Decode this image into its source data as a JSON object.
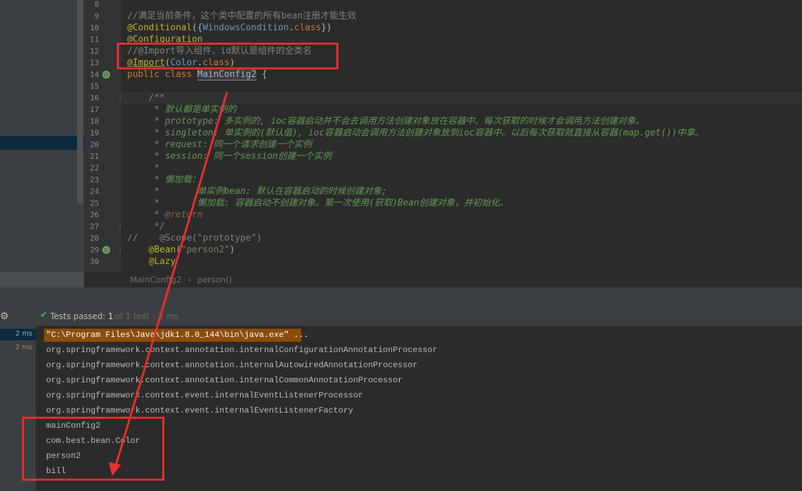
{
  "editor": {
    "line_numbers": [
      "8",
      "9",
      "10",
      "11",
      "12",
      "13",
      "14",
      "15",
      "16",
      "17",
      "18",
      "19",
      "20",
      "21",
      "22",
      "23",
      "24",
      "25",
      "26",
      "27",
      "28",
      "29",
      "30"
    ],
    "code": {
      "l9": "//满足当前条件，这个类中配置的所有bean注册才能生效",
      "l10_a": "@Conditional",
      "l10_b": "({",
      "l10_c": "WindowsCondition",
      "l10_d": ".",
      "l10_e": "class",
      "l10_f": "})",
      "l11": "@Configuration",
      "l12": "//@Import导入组件，id默认是组件的全类名",
      "l13_a": "@Import",
      "l13_b": "(",
      "l13_c": "Color",
      "l13_d": ".",
      "l13_e": "class",
      "l13_f": ")",
      "l14_a": "public class ",
      "l14_b": "MainConfig2",
      "l14_c": " {",
      "l16": "    /**",
      "l17": "     * 默认都是单实例的",
      "l18": "     * prototype: 多实例的, ioc容器启动并不会去调用方法创建对象放在容器中。每次获取的时候才会调用方法创建对象。",
      "l19": "     * singleton: 单实例的(默认值), ioc容器启动会调用方法创建对象放到ioc容器中。以后每次获取就直接从容器(map.get())中拿。",
      "l20": "     * request: 同一个请求创建一个实例",
      "l21": "     * session: 同一个session创建一个实例",
      "l22": "     *",
      "l23": "     * 懒加载：",
      "l24": "     *       单实例bean: 默认在容器启动的时候创建对象;",
      "l25": "     *       懒加载: 容器启动不创建对象。第一次使用(获取)Bean创建对象，并初始化。",
      "l26_a": "     * ",
      "l26_b": "@return",
      "l27": "     */",
      "l28": "//    @Scope(\"prototype\")",
      "l29_a": "    @Bean",
      "l29_b": "(",
      "l29_c": "\"person2\"",
      "l29_d": ")",
      "l30": "    @Lazy"
    }
  },
  "breadcrumbs": {
    "item1": "MainConfig2",
    "separator": "›",
    "item2": "person()"
  },
  "test_bar": {
    "label": "Tests passed:",
    "count": "1",
    "suffix": "of 1 test – 2 ms"
  },
  "test_tree": {
    "row1_time": "2 ms",
    "row2_time": "2 ms"
  },
  "console": {
    "lines": [
      "\"C:\\Program Files\\Java\\jdk1.8.0_144\\bin\\java.exe\" ...",
      "org.springframework.context.annotation.internalConfigurationAnnotationProcessor",
      "org.springframework.context.annotation.internalAutowiredAnnotationProcessor",
      "org.springframework.context.annotation.internalCommonAnnotationProcessor",
      "org.springframework.context.event.internalEventListenerProcessor",
      "org.springframework.context.event.internalEventListenerFactory",
      "mainConfig2",
      "com.best.bean.Color",
      "person2",
      "bill"
    ]
  },
  "colors": {
    "background": "#2b2b2b",
    "annotation_highlight": "#ec2d2d",
    "command_line_bg": "#8c4c06",
    "test_passed": "#59a869"
  }
}
